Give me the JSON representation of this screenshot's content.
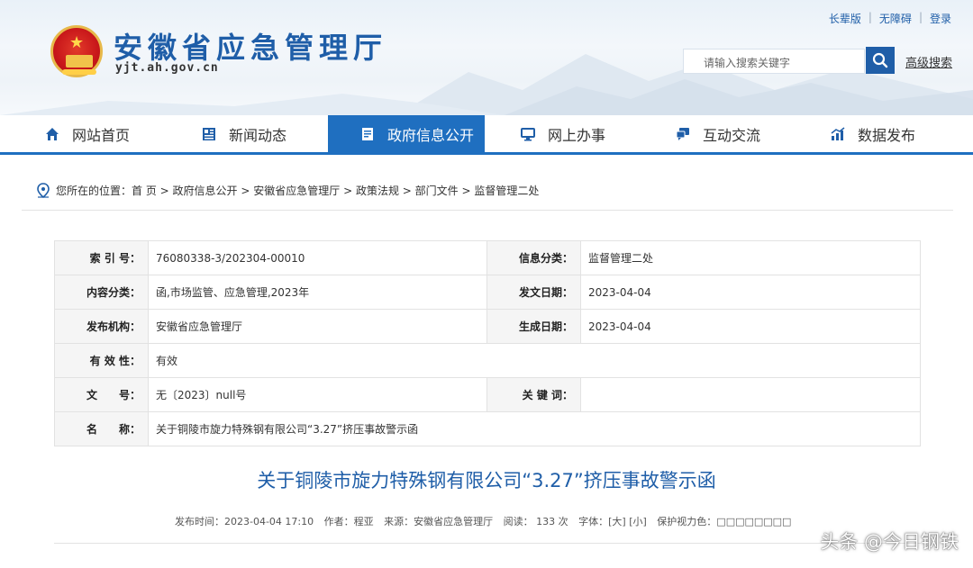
{
  "header": {
    "site_title": "安徽省应急管理厅",
    "site_domain": "yjt.ah.gov.cn",
    "top_links": [
      "长辈版",
      "无障碍",
      "登录"
    ],
    "search_placeholder": "请输入搜索关键字",
    "advanced_search": "高级搜索"
  },
  "nav": {
    "items": [
      {
        "label": "网站首页",
        "icon": "home-icon"
      },
      {
        "label": "新闻动态",
        "icon": "news-icon"
      },
      {
        "label": "政府信息公开",
        "icon": "document-icon",
        "active": true
      },
      {
        "label": "网上办事",
        "icon": "monitor-icon"
      },
      {
        "label": "互动交流",
        "icon": "chat-icon"
      },
      {
        "label": "数据发布",
        "icon": "chart-icon"
      }
    ]
  },
  "breadcrumb": {
    "prefix": "您所在的位置：",
    "items": [
      "首 页",
      "政府信息公开",
      "安徽省应急管理厅",
      "政策法规",
      "部门文件",
      "监督管理二处"
    ],
    "sep": " > "
  },
  "info": {
    "index_label": "索 引 号：",
    "index_value": "76080338-3/202304-00010",
    "category_label": "信息分类：",
    "category_value": "监督管理二处",
    "content_label": "内容分类：",
    "content_value": "函,市场监管、应急管理,2023年",
    "issue_date_label": "发文日期：",
    "issue_date_value": "2023-04-04",
    "publisher_label": "发布机构：",
    "publisher_value": "安徽省应急管理厅",
    "gen_date_label": "生成日期：",
    "gen_date_value": "2023-04-04",
    "validity_label": "有 效 性：",
    "validity_value": "有效",
    "docno_label": "文　　号：",
    "docno_value": "无〔2023〕null号",
    "keywords_label": "关 键 词：",
    "keywords_value": "",
    "name_label": "名　　称：",
    "name_value": "关于铜陵市旋力特殊钢有限公司“3.27”挤压事故警示函"
  },
  "document": {
    "title": "关于铜陵市旋力特殊钢有限公司“3.27”挤压事故警示函",
    "meta_time": "发布时间：2023-04-04 17:10",
    "meta_author": "作者：程亚",
    "meta_source": "来源：安徽省应急管理厅",
    "meta_reads": "阅读： 133 次",
    "meta_font": "字体：[大] [小]",
    "meta_eye": "保护视力色：□□□□□□□□"
  },
  "watermark": "头条 @今日钢铁",
  "colors": {
    "brand_blue": "#1f6fc0",
    "title_blue": "#1f5ea8"
  }
}
